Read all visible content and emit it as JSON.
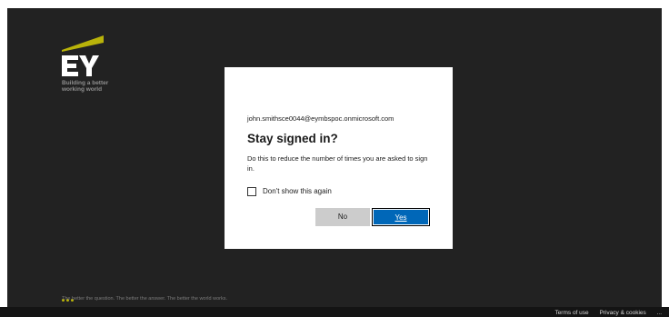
{
  "brand": {
    "logo_text": "EY",
    "tagline_line1": "Building a better",
    "tagline_line2": "working world",
    "accent_color": "#ffe600"
  },
  "dialog": {
    "identity": "john.smithsce0044@eymbspoc.onmicrosoft.com",
    "title": "Stay signed in?",
    "description": "Do this to reduce the number of times you are asked to sign in.",
    "checkbox_label": "Don't show this again",
    "checkbox_checked": false,
    "no_button_label": "No",
    "yes_button_label": "Yes",
    "primary_color": "#0067b8"
  },
  "footer": {
    "slogan": "The better the question. The better the answer. The better the world works.",
    "terms_label": "Terms of use",
    "privacy_label": "Privacy & cookies",
    "more_label": "..."
  }
}
